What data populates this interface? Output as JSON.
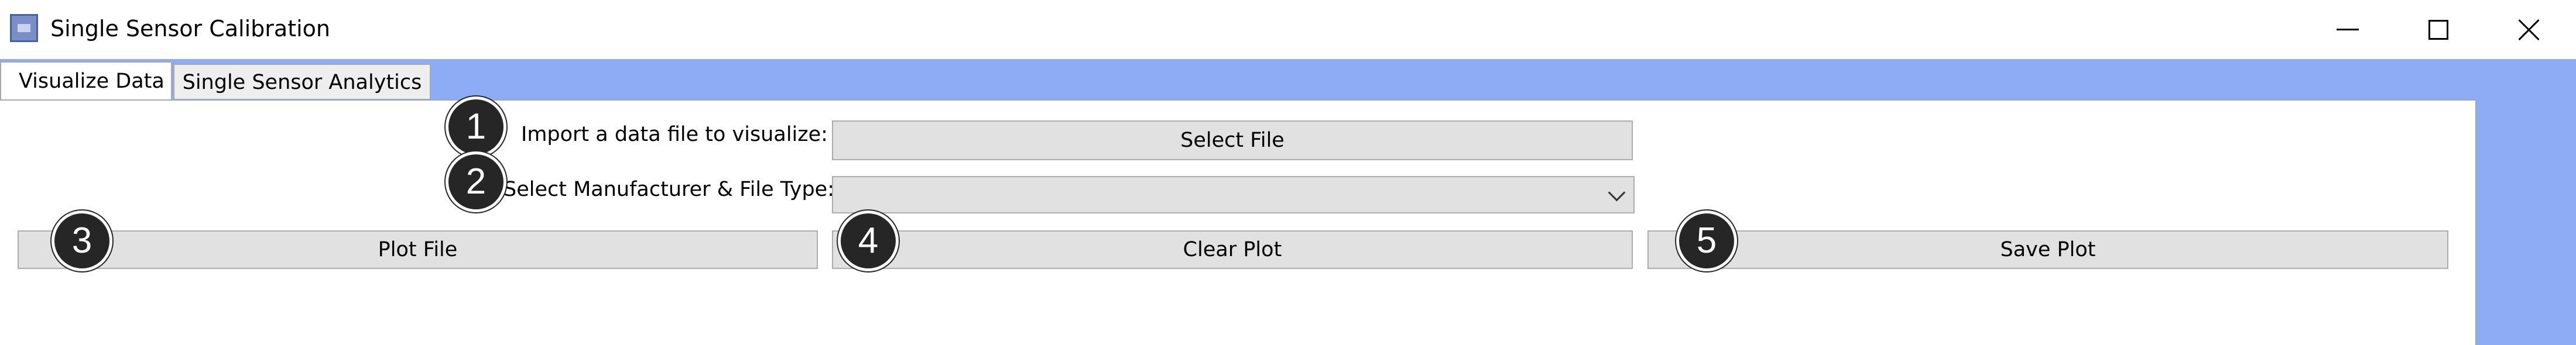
{
  "window": {
    "title": "Single Sensor Calibration",
    "app_icon": "app-window-icon"
  },
  "window_controls": {
    "minimize_icon": "minimize-icon",
    "maximize_icon": "maximize-icon",
    "close_icon": "close-icon"
  },
  "tabs": [
    {
      "label": "Visualize Data",
      "active": true
    },
    {
      "label": "Single Sensor Analytics",
      "active": false
    }
  ],
  "import": {
    "label": "Import a data file to visualize:",
    "button": "Select File"
  },
  "manufacturer": {
    "label": "Select Manufacturer & File Type:",
    "selected_value": ""
  },
  "actions": {
    "plot": "Plot File",
    "clear": "Clear Plot",
    "save": "Save Plot"
  },
  "step_badges": [
    "1",
    "2",
    "3",
    "4",
    "5"
  ],
  "colors": {
    "tab_strip_background": "#8eacf5",
    "button_background": "#e1e1e1",
    "badge_background": "#262626"
  }
}
